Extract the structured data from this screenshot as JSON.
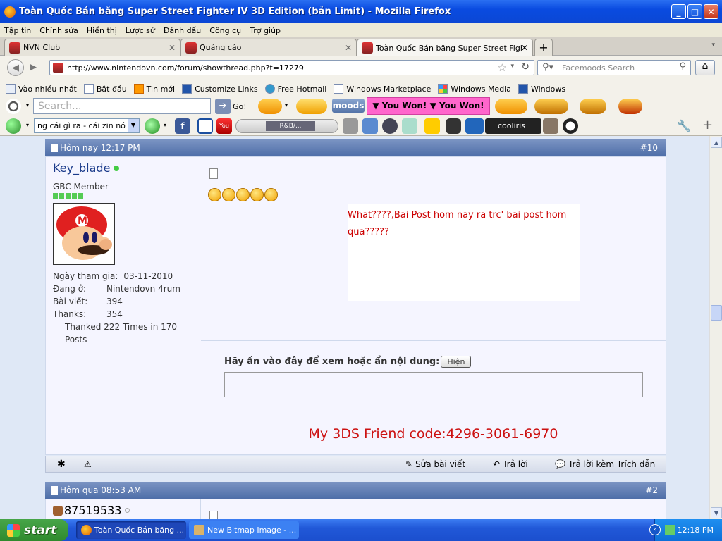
{
  "window": {
    "title": "Toàn Quốc Bán băng Super Street Fighter IV 3D Edition (bản Limit) - Mozilla Firefox"
  },
  "menu": [
    "Tập tin",
    "Chỉnh sửa",
    "Hiển thị",
    "Lược sử",
    "Đánh dấu",
    "Công cụ",
    "Trợ giúp"
  ],
  "tabs": [
    {
      "label": "NVN Club"
    },
    {
      "label": "Quảng cáo"
    },
    {
      "label": "Toàn Quốc Bán băng Super Street Fighte..."
    }
  ],
  "nav": {
    "url": "http://www.nintendovn.com/forum/showthread.php?t=17279",
    "search_placeholder": "Facemoods Search"
  },
  "bookmarks": [
    "Vào nhiều nhất",
    "Bắt đầu",
    "Tin mới",
    "Customize Links",
    "Free Hotmail",
    "Windows Marketplace",
    "Windows Media",
    "Windows"
  ],
  "toolbar1": {
    "search_placeholder": "Search...",
    "go": "Go!",
    "moods": "moods",
    "banner": "▼ You Won! ▼ You Won!"
  },
  "toolbar2": {
    "select_value": "ng cái gì ra - cái zin nó có r",
    "radio": "R&B/..."
  },
  "post1": {
    "date": "Hôm nay 12:17 PM",
    "number": "#10",
    "username": "Key_blade",
    "rank": "GBC Member",
    "details": [
      {
        "label": "Ngày tham gia:",
        "value": "03-11-2010"
      },
      {
        "label": "Đang ở:",
        "value": "Nintendovn 4rum"
      },
      {
        "label": "Bài viết:",
        "value": "394"
      },
      {
        "label": "Thanks:",
        "value": "354"
      }
    ],
    "thanked": "Thanked 222 Times in 170 Posts",
    "message_line1": "What????,Bai Post hom nay ra trc' bai post hom",
    "message_line2": "qua?????",
    "spoiler_label": "Hãy ấn vào đây để xem hoặc ẩn nội dung:",
    "spoiler_button": "Hiện",
    "signature": "My 3DS Friend code:4296-3061-6970",
    "edit": "Sửa bài viết",
    "reply": "Trả lời",
    "quote": "Trả lời kèm Trích dẫn"
  },
  "post2": {
    "date": "Hôm qua 08:53 AM",
    "number": "#2",
    "username": "87519533"
  },
  "taskbar": {
    "start": "start",
    "tasks": [
      "Toàn Quốc Bán băng ...",
      "New Bitmap Image - ..."
    ],
    "clock": "12:18 PM"
  },
  "colors": {
    "accent": "#4e6ea8",
    "message_red": "#cc0000",
    "username_blue": "#1a3a8a",
    "banner_pink": "#ff66cc"
  }
}
